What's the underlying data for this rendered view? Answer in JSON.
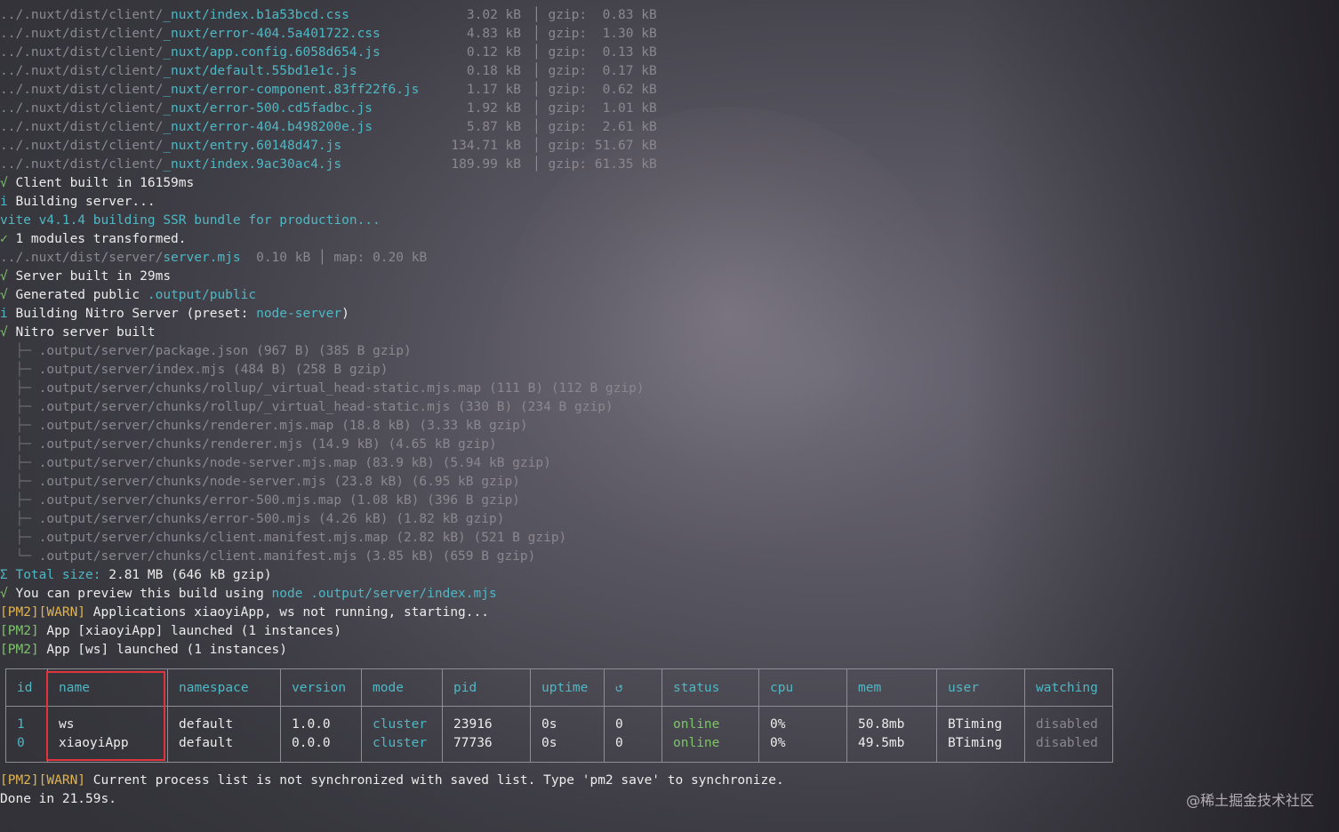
{
  "build_assets": [
    {
      "prefix": "../.nuxt/dist/client/",
      "file": "_nuxt/index.b1a53bcd.css",
      "size": "3.02 kB",
      "gzip": "gzip:  0.83 kB"
    },
    {
      "prefix": "../.nuxt/dist/client/",
      "file": "_nuxt/error-404.5a401722.css",
      "size": "4.83 kB",
      "gzip": "gzip:  1.30 kB"
    },
    {
      "prefix": "../.nuxt/dist/client/",
      "file": "_nuxt/app.config.6058d654.js",
      "size": "0.12 kB",
      "gzip": "gzip:  0.13 kB"
    },
    {
      "prefix": "../.nuxt/dist/client/",
      "file": "_nuxt/default.55bd1e1c.js",
      "size": "0.18 kB",
      "gzip": "gzip:  0.17 kB"
    },
    {
      "prefix": "../.nuxt/dist/client/",
      "file": "_nuxt/error-component.83ff22f6.js",
      "size": "1.17 kB",
      "gzip": "gzip:  0.62 kB"
    },
    {
      "prefix": "../.nuxt/dist/client/",
      "file": "_nuxt/error-500.cd5fadbc.js",
      "size": "1.92 kB",
      "gzip": "gzip:  1.01 kB"
    },
    {
      "prefix": "../.nuxt/dist/client/",
      "file": "_nuxt/error-404.b498200e.js",
      "size": "5.87 kB",
      "gzip": "gzip:  2.61 kB"
    },
    {
      "prefix": "../.nuxt/dist/client/",
      "file": "_nuxt/entry.60148d47.js",
      "size": "134.71 kB",
      "gzip": "gzip: 51.67 kB"
    },
    {
      "prefix": "../.nuxt/dist/client/",
      "file": "_nuxt/index.9ac30ac4.js",
      "size": "189.99 kB",
      "gzip": "gzip: 61.35 kB"
    }
  ],
  "log": {
    "client_built": {
      "mark": "√",
      "text": " Client built in 16159ms"
    },
    "building_server": {
      "mark": "i",
      "text": " Building server..."
    },
    "vite_ssr": "vite v4.1.4 building SSR bundle for production...",
    "modules": {
      "mark": "✓",
      "text": " 1 modules transformed."
    },
    "server_asset": {
      "prefix": "../.nuxt/dist/server/",
      "file": "server.mjs",
      "size": "0.10 kB",
      "pipe": "│",
      "map": "map: 0.20 kB"
    },
    "server_built": {
      "mark": "√",
      "text": " Server built in 29ms"
    },
    "generated": {
      "mark": "√",
      "text": " Generated public ",
      "path": ".output/public"
    },
    "nitro_building": {
      "mark": "i",
      "text": " Building Nitro Server (preset: ",
      "preset": "node-server",
      "close": ")"
    },
    "nitro_built": {
      "mark": "√",
      "text": " Nitro server built"
    }
  },
  "nitro_files": [
    ".output/server/package.json (967 B) (385 B gzip)",
    ".output/server/index.mjs (484 B) (258 B gzip)",
    ".output/server/chunks/rollup/_virtual_head-static.mjs.map (111 B) (112 B gzip)",
    ".output/server/chunks/rollup/_virtual_head-static.mjs (330 B) (234 B gzip)",
    ".output/server/chunks/renderer.mjs.map (18.8 kB) (3.33 kB gzip)",
    ".output/server/chunks/renderer.mjs (14.9 kB) (4.65 kB gzip)",
    ".output/server/chunks/node-server.mjs.map (83.9 kB) (5.94 kB gzip)",
    ".output/server/chunks/node-server.mjs (23.8 kB) (6.95 kB gzip)",
    ".output/server/chunks/error-500.mjs.map (1.08 kB) (396 B gzip)",
    ".output/server/chunks/error-500.mjs (4.26 kB) (1.82 kB gzip)",
    ".output/server/chunks/client.manifest.mjs.map (2.82 kB) (521 B gzip)",
    ".output/server/chunks/client.manifest.mjs (3.85 kB) (659 B gzip)"
  ],
  "summary": {
    "total_mark": "Σ",
    "total_label": " Total size:",
    "total_value": " 2.81 MB (646 kB gzip)",
    "preview_mark": "√",
    "preview_text": " You can preview this build using ",
    "preview_cmd": "node .output/server/index.mjs"
  },
  "pm2_log": [
    {
      "tag": "[PM2][WARN]",
      "text": " Applications xiaoyiApp, ws not running, starting..."
    },
    {
      "tag": "[PM2]",
      "text": " App [xiaoyiApp] launched (1 instances)"
    },
    {
      "tag": "[PM2]",
      "text": " App [ws] launched (1 instances)"
    }
  ],
  "pm2_table": {
    "headers": [
      "id",
      "name",
      "namespace",
      "version",
      "mode",
      "pid",
      "uptime",
      "↺",
      "status",
      "cpu",
      "mem",
      "user",
      "watching"
    ],
    "col_ids": [
      "1\n0",
      "ws\nxiaoyiApp",
      "default\ndefault",
      "1.0.0\n0.0.0",
      "cluster\ncluster",
      "23916\n77736",
      "0s\n0s",
      "0\n0",
      "online\nonline",
      "0%\n0%",
      "50.8mb\n49.5mb",
      "BTiming\nBTiming",
      "disabled\ndisabled"
    ]
  },
  "footer": {
    "warn_tag": "[PM2][WARN]",
    "warn_text": " Current process list is not synchronized with saved list. Type 'pm2 save' to synchronize.",
    "done": "Done in 21.59s."
  },
  "watermark": "@稀土掘金技术社区",
  "colors": {
    "accent_cyan": "#4fb7c4",
    "ok_green": "#7ec46a",
    "warn_yellow": "#e1b44f",
    "highlight_red": "#e0333b"
  }
}
